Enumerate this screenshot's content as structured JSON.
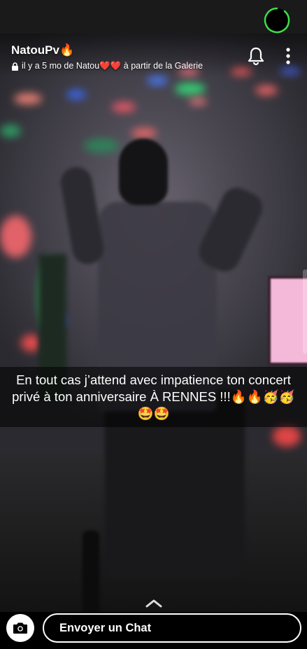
{
  "header": {
    "username": "NatouPv🔥",
    "subline": "il y a 5 mo de Natou❤️❤️ à partir de la Galerie",
    "icons": [
      "lock-icon",
      "bell-icon",
      "more-vertical-icon",
      "story-timer-ring"
    ]
  },
  "caption": {
    "text": "En tout cas j’attend avec impatience ton concert privé à ton anniversaire À RENNES !!!🔥🔥🥳🥳🤩🤩"
  },
  "chat": {
    "placeholder": "Envoyer un Chat",
    "icons": [
      "camera-icon",
      "chevron-up-icon"
    ]
  },
  "colors": {
    "timer_ring": "#3ddc4c",
    "caption_band": "rgba(0,0,0,0.55)",
    "chat_bar": "#000000"
  }
}
